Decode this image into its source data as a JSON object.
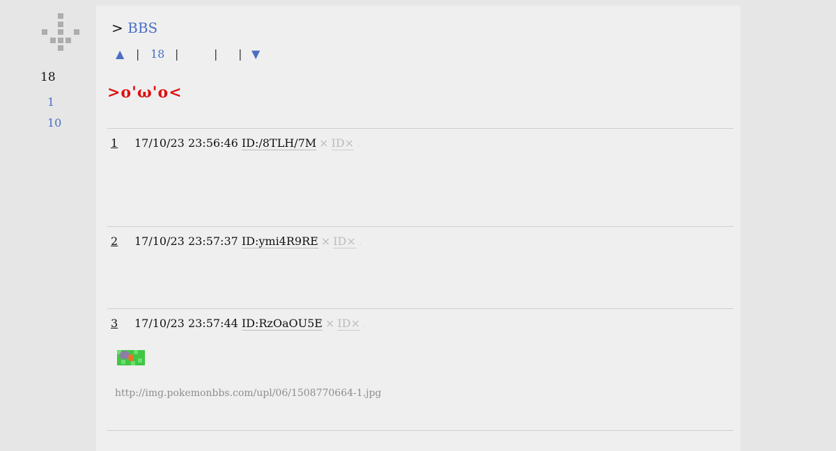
{
  "sidebar": {
    "count": "18",
    "links": [
      "1",
      "10"
    ]
  },
  "breadcrumb": {
    "prefix": ">",
    "board": "BBS"
  },
  "nav": {
    "up_arrow": "▲",
    "sep": "|",
    "count": "18",
    "down_arrow": "▼"
  },
  "thread_title": ">o'ω'o<",
  "posts": [
    {
      "num": "1",
      "date": "17/10/23 23:56:46",
      "id": "ID:/8TLH/7M",
      "ng": "×",
      "ng_id": "ID×",
      "dot": "."
    },
    {
      "num": "2",
      "date": "17/10/23 23:57:37",
      "id": "ID:ymi4R9RE",
      "ng": "×",
      "ng_id": "ID×",
      "dot": "."
    },
    {
      "num": "3",
      "date": "17/10/23 23:57:44",
      "id": "ID:RzOaOU5E",
      "ng": "×",
      "ng_id": "ID×",
      "dot": ".",
      "image_url": "http://img.pokemonbbs.com/upl/06/1508770664-1.jpg"
    }
  ],
  "colors": {
    "link": "#4a6fc4",
    "title_red": "#dd1111",
    "muted": "#bbbbbb",
    "panel_bg": "#efefef",
    "page_bg": "#e6e6e6"
  }
}
